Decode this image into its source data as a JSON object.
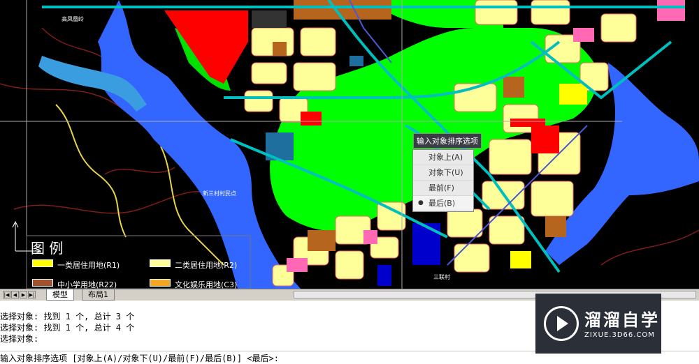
{
  "map": {
    "labels": {
      "north_village": "高凤凰岭",
      "southwest_village": "新三村村民点",
      "south_village": "三联村"
    },
    "legend": {
      "title": "图 例",
      "items": [
        {
          "label": "一类居住用地(R1)",
          "color": "#ffff00"
        },
        {
          "label": "二类居住用地(R2)",
          "color": "#ffff99"
        },
        {
          "label": "中小学用地(R22)",
          "color": "#a0522d"
        },
        {
          "label": "文化娱乐用地(C3)",
          "color": "#f5a623"
        }
      ]
    }
  },
  "tooltip": {
    "text": "输入对象排序选项"
  },
  "context_menu": {
    "items": [
      {
        "label": "对象上(A)"
      },
      {
        "label": "对象下(U)"
      },
      {
        "label": "最前(F)"
      },
      {
        "label": "最后(B)",
        "selected": true
      }
    ]
  },
  "tabs": {
    "model": "模型",
    "layout1": "布局1"
  },
  "command": {
    "history": [
      "选择对象: 找到 1 个, 总计 3 个",
      "选择对象: 找到 1 个, 总计 4 个",
      "选择对象:"
    ],
    "prompt": "输入对象排序选项 [对象上(A)/对象下(U)/最前(F)/最后(B)] <最后>:"
  },
  "watermark": {
    "brand": "溜溜自学",
    "url": "ZIXUE.3D66.COM"
  },
  "colors": {
    "green_space": "#00ff00",
    "water": "#3366ff",
    "road_cyan": "#00bfbf",
    "residential": "#ffff99",
    "commercial_red": "#ff0000",
    "background": "#000000"
  }
}
